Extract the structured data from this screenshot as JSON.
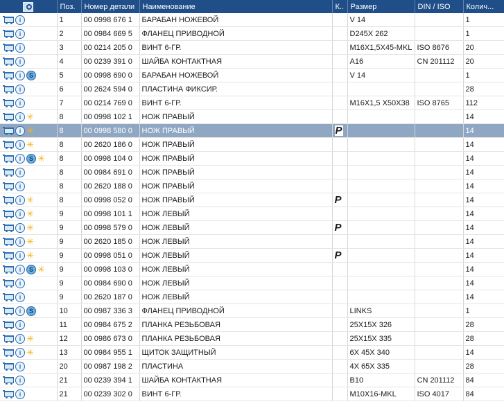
{
  "header": {
    "icon_col": "view-icon",
    "pos": "Поз.",
    "part": "Номер детали",
    "name": "Наименование",
    "k": "К..",
    "size": "Размер",
    "din": "DIN / ISO",
    "qty": "Колич..."
  },
  "rows": [
    {
      "icons": [
        "cart",
        "info"
      ],
      "pos": "1",
      "part": "00 0998 676 1",
      "name": "БАРАБАН НОЖЕВОЙ",
      "k": "",
      "size": "V 14",
      "din": "",
      "qty": "1"
    },
    {
      "icons": [
        "cart",
        "info"
      ],
      "pos": "2",
      "part": "00 0984 669 5",
      "name": "ФЛАНЕЦ ПРИВОДНОЙ",
      "k": "",
      "size": "D245X 262",
      "din": "",
      "qty": "1"
    },
    {
      "icons": [
        "cart",
        "info"
      ],
      "pos": "3",
      "part": "00 0214 205 0",
      "name": "ВИНТ 6-ГР.",
      "k": "",
      "size": "M16X1,5X45-MKL",
      "din": "ISO 8676",
      "qty": "20"
    },
    {
      "icons": [
        "cart",
        "info"
      ],
      "pos": "4",
      "part": "00 0239 391 0",
      "name": "ШАЙБА КОНТАКТНАЯ",
      "k": "",
      "size": "A16",
      "din": "CN 201112",
      "qty": "20"
    },
    {
      "icons": [
        "cart",
        "info",
        "s"
      ],
      "pos": "5",
      "part": "00 0998 690 0",
      "name": "БАРАБАН НОЖЕВОЙ",
      "k": "",
      "size": "V 14",
      "din": "",
      "qty": "1"
    },
    {
      "icons": [
        "cart",
        "info"
      ],
      "pos": "6",
      "part": "00 2624 594 0",
      "name": "ПЛАСТИНА ФИКСИР.",
      "k": "",
      "size": "",
      "din": "",
      "qty": "28"
    },
    {
      "icons": [
        "cart",
        "info"
      ],
      "pos": "7",
      "part": "00 0214 769 0",
      "name": "ВИНТ 6-ГР.",
      "k": "",
      "size": "M16X1,5 X50X38",
      "din": "ISO 8765",
      "qty": "112"
    },
    {
      "icons": [
        "cart",
        "info",
        "star"
      ],
      "pos": "8",
      "part": "00 0998 102 1",
      "name": "НОЖ ПРАВЫЙ",
      "k": "",
      "size": "",
      "din": "",
      "qty": "14"
    },
    {
      "icons": [
        "cart",
        "info",
        "star"
      ],
      "pos": "8",
      "part": "00 0998 580 0",
      "name": "НОЖ ПРАВЫЙ",
      "k": "P",
      "size": "",
      "din": "",
      "qty": "14",
      "selected": true
    },
    {
      "icons": [
        "cart",
        "info",
        "star"
      ],
      "pos": "8",
      "part": "00 2620 186 0",
      "name": "НОЖ ПРАВЫЙ",
      "k": "",
      "size": "",
      "din": "",
      "qty": "14"
    },
    {
      "icons": [
        "cart",
        "info",
        "s",
        "star"
      ],
      "pos": "8",
      "part": "00 0998 104 0",
      "name": "НОЖ ПРАВЫЙ",
      "k": "",
      "size": "",
      "din": "",
      "qty": "14"
    },
    {
      "icons": [
        "cart",
        "info"
      ],
      "pos": "8",
      "part": "00 0984 691 0",
      "name": "НОЖ ПРАВЫЙ",
      "k": "",
      "size": "",
      "din": "",
      "qty": "14"
    },
    {
      "icons": [
        "cart",
        "info"
      ],
      "pos": "8",
      "part": "00 2620 188 0",
      "name": "НОЖ ПРАВЫЙ",
      "k": "",
      "size": "",
      "din": "",
      "qty": "14"
    },
    {
      "icons": [
        "cart",
        "info",
        "star"
      ],
      "pos": "8",
      "part": "00 0998 052 0",
      "name": "НОЖ ПРАВЫЙ",
      "k": "P",
      "size": "",
      "din": "",
      "qty": "14"
    },
    {
      "icons": [
        "cart",
        "info",
        "star"
      ],
      "pos": "9",
      "part": "00 0998 101 1",
      "name": "НОЖ ЛЕВЫЙ",
      "k": "",
      "size": "",
      "din": "",
      "qty": "14"
    },
    {
      "icons": [
        "cart",
        "info",
        "star"
      ],
      "pos": "9",
      "part": "00 0998 579 0",
      "name": "НОЖ ЛЕВЫЙ",
      "k": "P",
      "size": "",
      "din": "",
      "qty": "14"
    },
    {
      "icons": [
        "cart",
        "info",
        "star"
      ],
      "pos": "9",
      "part": "00 2620 185 0",
      "name": "НОЖ ЛЕВЫЙ",
      "k": "",
      "size": "",
      "din": "",
      "qty": "14"
    },
    {
      "icons": [
        "cart",
        "info",
        "star"
      ],
      "pos": "9",
      "part": "00 0998 051 0",
      "name": "НОЖ ЛЕВЫЙ",
      "k": "P",
      "size": "",
      "din": "",
      "qty": "14"
    },
    {
      "icons": [
        "cart",
        "info",
        "s",
        "star"
      ],
      "pos": "9",
      "part": "00 0998 103 0",
      "name": "НОЖ ЛЕВЫЙ",
      "k": "",
      "size": "",
      "din": "",
      "qty": "14"
    },
    {
      "icons": [
        "cart",
        "info"
      ],
      "pos": "9",
      "part": "00 0984 690 0",
      "name": "НОЖ ЛЕВЫЙ",
      "k": "",
      "size": "",
      "din": "",
      "qty": "14"
    },
    {
      "icons": [
        "cart",
        "info"
      ],
      "pos": "9",
      "part": "00 2620 187 0",
      "name": "НОЖ ЛЕВЫЙ",
      "k": "",
      "size": "",
      "din": "",
      "qty": "14"
    },
    {
      "icons": [
        "cart",
        "info",
        "s"
      ],
      "pos": "10",
      "part": "00 0987 336 3",
      "name": "ФЛАНЕЦ ПРИВОДНОЙ",
      "k": "",
      "size": "LINKS",
      "din": "",
      "qty": "1"
    },
    {
      "icons": [
        "cart",
        "info"
      ],
      "pos": "11",
      "part": "00 0984 675 2",
      "name": "ПЛАНКА РЕЗЬБОВАЯ",
      "k": "",
      "size": "25X15X 326",
      "din": "",
      "qty": "28"
    },
    {
      "icons": [
        "cart",
        "info",
        "star"
      ],
      "pos": "12",
      "part": "00 0986 673 0",
      "name": "ПЛАНКА РЕЗЬБОВАЯ",
      "k": "",
      "size": "25X15X 335",
      "din": "",
      "qty": "28"
    },
    {
      "icons": [
        "cart",
        "info",
        "star"
      ],
      "pos": "13",
      "part": "00 0984 955 1",
      "name": "ЩИТОК ЗАЩИТНЫЙ",
      "k": "",
      "size": "6X 45X 340",
      "din": "",
      "qty": "14"
    },
    {
      "icons": [
        "cart",
        "info"
      ],
      "pos": "20",
      "part": "00 0987 198 2",
      "name": "ПЛАСТИНА",
      "k": "",
      "size": "4X 65X 335",
      "din": "",
      "qty": "28"
    },
    {
      "icons": [
        "cart",
        "info"
      ],
      "pos": "21",
      "part": "00 0239 394 1",
      "name": "ШАЙБА КОНТАКТНАЯ",
      "k": "",
      "size": "B10",
      "din": "CN 201112",
      "qty": "84"
    },
    {
      "icons": [
        "cart",
        "info"
      ],
      "pos": "21",
      "part": "00 0239 302 0",
      "name": "ВИНТ 6-ГР.",
      "k": "",
      "size": "M10X16-MKL",
      "din": "ISO 4017",
      "qty": "84"
    }
  ]
}
